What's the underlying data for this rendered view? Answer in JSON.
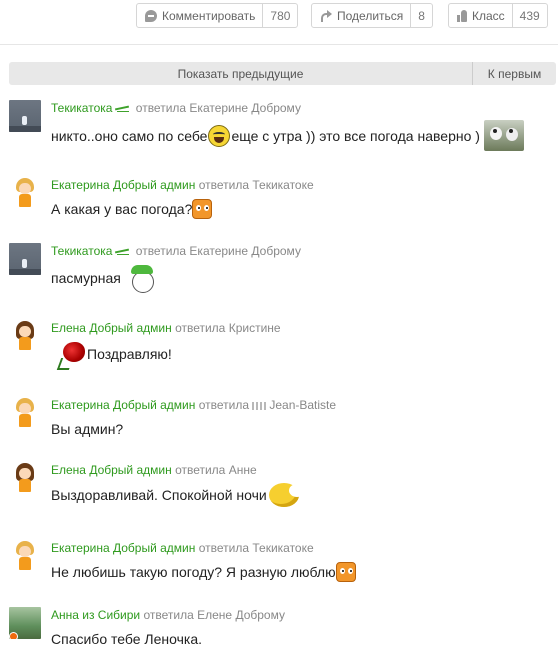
{
  "actions": {
    "comment": {
      "label": "Комментировать",
      "count": "780"
    },
    "share": {
      "label": "Поделиться",
      "count": "8"
    },
    "like": {
      "label": "Класс",
      "count": "439"
    }
  },
  "nav": {
    "show_previous": "Показать предыдущие",
    "to_first": "К первым"
  },
  "comments": [
    {
      "author": "Текикатока",
      "verb": "ответила",
      "target": "Екатерине Доброму",
      "text": "никто..оно само по себе",
      "text2": "еще с утра )) это все погода наверно )"
    },
    {
      "author": "Екатерина Добрый админ",
      "verb": "ответила",
      "target": "Текикатоке",
      "text": "А какая у вас погода?"
    },
    {
      "author": "Текикатока",
      "verb": "ответила",
      "target": "Екатерине Доброму",
      "text": "пасмурная"
    },
    {
      "author": "Елена Добрый админ",
      "verb": "ответила",
      "target": "Кристине",
      "text": "Поздравляю!"
    },
    {
      "author": "Екатерина Добрый админ",
      "verb": "ответила",
      "target": "Jean-Batiste",
      "text": "Вы админ?"
    },
    {
      "author": "Елена Добрый админ",
      "verb": "ответила",
      "target": "Анне",
      "text": "Выздоравливай. Спокойной ночи"
    },
    {
      "author": "Екатерина Добрый админ",
      "verb": "ответила",
      "target": "Текикатоке",
      "text": "Не любишь такую погоду? Я разную люблю"
    },
    {
      "author": "Анна из Сибири",
      "verb": "ответила",
      "target": "Елене Доброму",
      "text": "Спасибо тебе Леночка."
    }
  ]
}
